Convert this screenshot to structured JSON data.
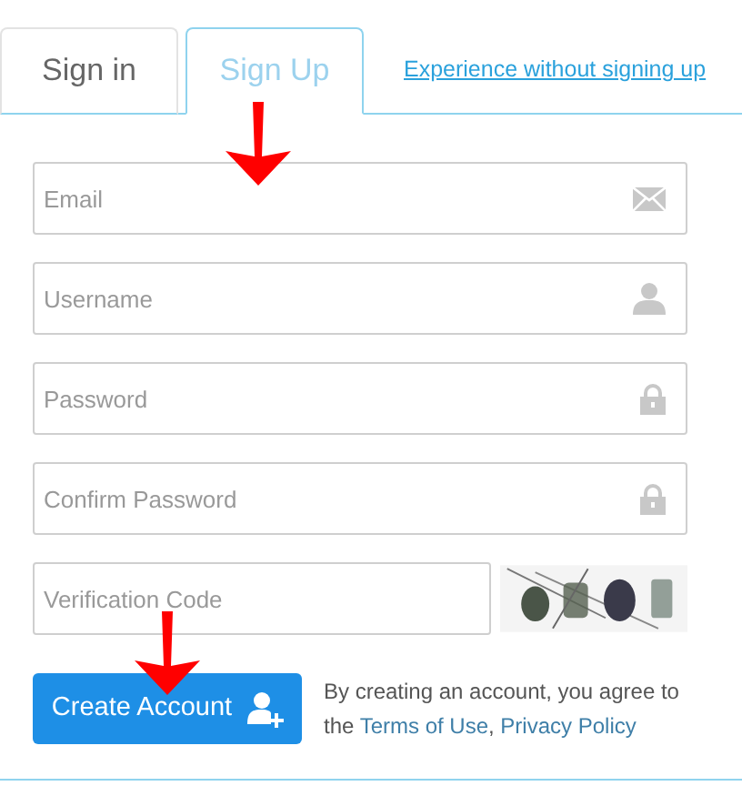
{
  "tabs": [
    {
      "label": "Sign in",
      "selected": false
    },
    {
      "label": "Sign Up",
      "selected": true
    }
  ],
  "skip_link": "Experience without signing up",
  "fields": [
    {
      "placeholder": "Email",
      "kind": "mail"
    },
    {
      "placeholder": "Username",
      "kind": "user"
    },
    {
      "placeholder": "Password",
      "kind": "lock"
    },
    {
      "placeholder": "Confirm Password",
      "kind": "lock"
    }
  ],
  "verification": {
    "placeholder": "Verification Code"
  },
  "create_button": "Create Account",
  "terms": {
    "before": "By creating an account, you agree to the",
    "links": [
      "Terms of Use",
      "Privacy Policy"
    ],
    "separator": ","
  }
}
